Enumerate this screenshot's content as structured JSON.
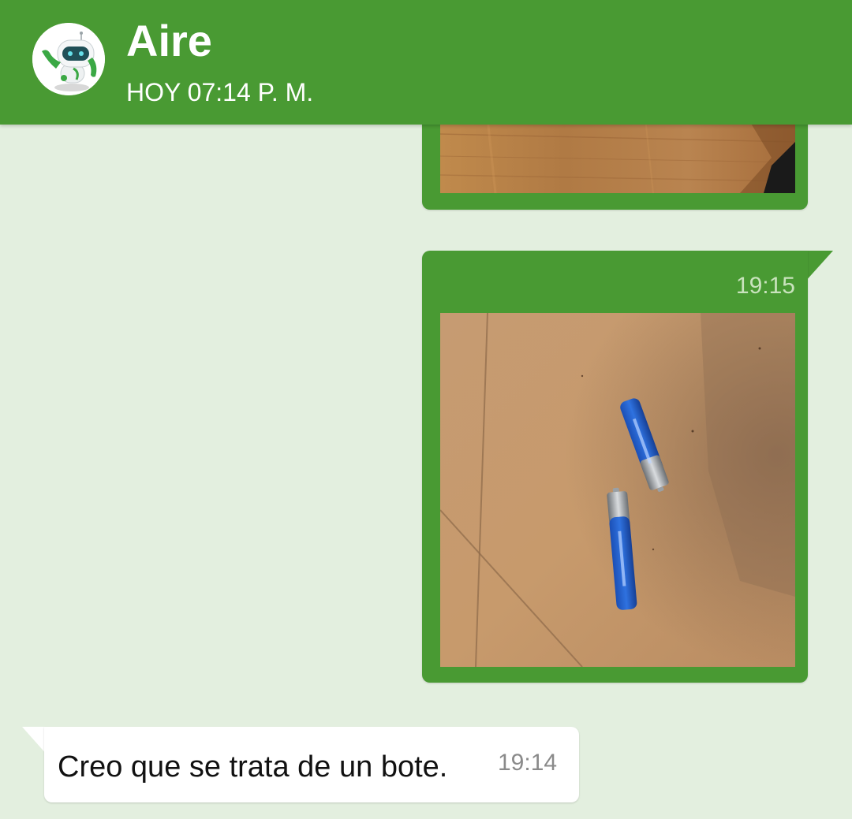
{
  "header": {
    "contact_name": "Aire",
    "status": "HOY 07:14 P. M.",
    "avatar_icon": "robot-mascot-icon",
    "background_color": "#499a33"
  },
  "messages": [
    {
      "direction": "outgoing",
      "type": "image",
      "content": "wooden floor photo (partially scrolled out of view)"
    },
    {
      "direction": "outgoing",
      "type": "image",
      "time": "19:15",
      "content": "photo of two blue AAA batteries on a wooden floor"
    },
    {
      "direction": "incoming",
      "type": "text",
      "text": "Creo que se trata de un bote.",
      "time": "19:14"
    }
  ],
  "colors": {
    "chat_background": "#e3efdf",
    "outgoing_bubble": "#499a33",
    "incoming_bubble": "#ffffff"
  }
}
